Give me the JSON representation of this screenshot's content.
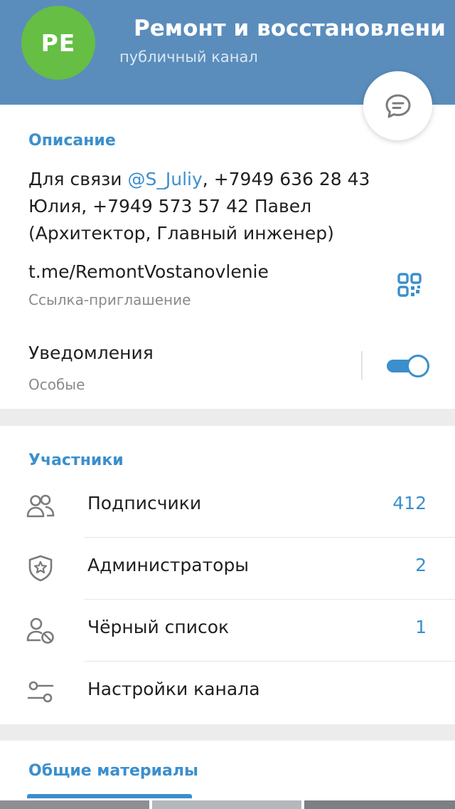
{
  "header": {
    "avatar_initials": "PE",
    "title": "Ремонт и восстановление",
    "subtitle": "публичный канал"
  },
  "info": {
    "section_title": "Описание",
    "description_prefix": "Для связи ",
    "mention": "@S_Juliy",
    "description_line1_suffix": ", +7949 636 28 43",
    "description_line2": "Юлия, +7949 573 57 42 Павел",
    "description_line3": "(Архитектор, Главный инженер)",
    "link": "t.me/RemontVostanovlenie",
    "link_sub": "Ссылка-приглашение",
    "notifications_label": "Уведомления",
    "notifications_sub": "Особые",
    "notifications_enabled": true
  },
  "members": {
    "section_title": "Участники",
    "rows": [
      {
        "label": "Подписчики",
        "count": "412",
        "icon": "users-icon"
      },
      {
        "label": "Администраторы",
        "count": "2",
        "icon": "shield-star-icon"
      },
      {
        "label": "Чёрный список",
        "count": "1",
        "icon": "user-blocked-icon"
      },
      {
        "label": "Настройки канала",
        "count": "",
        "icon": "sliders-icon"
      }
    ]
  },
  "media": {
    "section_title": "Общие материалы"
  },
  "colors": {
    "header": "#5a8dbc",
    "accent": "#3b8fcd",
    "avatar": "#66be44"
  }
}
